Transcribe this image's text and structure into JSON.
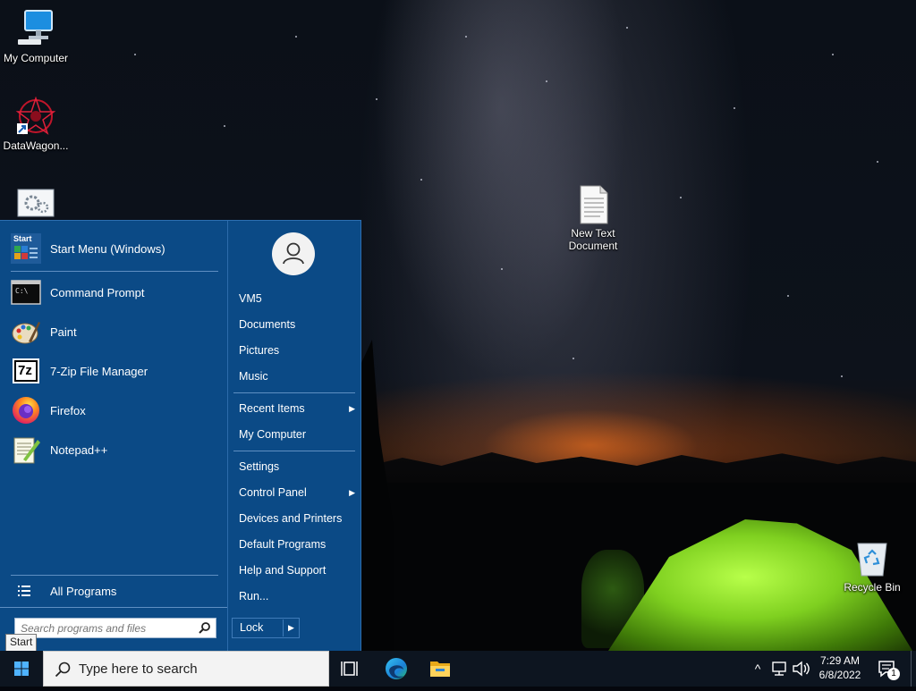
{
  "desktop": {
    "icons": [
      {
        "label": "My Computer"
      },
      {
        "label": "DataWagon..."
      },
      {
        "label": ""
      },
      {
        "label": "New Text Document"
      },
      {
        "label": "Recycle Bin"
      }
    ]
  },
  "start_menu": {
    "programs": [
      {
        "label": "Start Menu (Windows)",
        "icon": "start-menu-icon"
      },
      {
        "label": "Command Prompt",
        "icon": "command-prompt-icon"
      },
      {
        "label": "Paint",
        "icon": "paint-icon"
      },
      {
        "label": "7-Zip File Manager",
        "icon": "seven-zip-icon"
      },
      {
        "label": "Firefox",
        "icon": "firefox-icon"
      },
      {
        "label": "Notepad++",
        "icon": "notepad-plus-plus-icon"
      }
    ],
    "start_icon_text": "Start",
    "cmd_icon_text": "C:\\",
    "seven_zip_icon_text": "7z",
    "all_programs": "All Programs",
    "search_placeholder": "Search programs and files",
    "places": [
      {
        "label": "VM5"
      },
      {
        "label": "Documents"
      },
      {
        "label": "Pictures"
      },
      {
        "label": "Music"
      },
      {
        "label": "Recent Items",
        "submenu": true
      },
      {
        "label": "My Computer"
      },
      {
        "label": "Settings"
      },
      {
        "label": "Control Panel",
        "submenu": true
      },
      {
        "label": "Devices and Printers"
      },
      {
        "label": "Default Programs"
      },
      {
        "label": "Help and Support"
      },
      {
        "label": "Run..."
      }
    ],
    "submenu_arrow": "▶",
    "lock_label": "Lock",
    "lock_arrow": "▶"
  },
  "tooltip": "Start",
  "taskbar": {
    "search_placeholder": "Type here to search",
    "time": "7:29 AM",
    "date": "6/8/2022",
    "notification_count": "1",
    "tray_chevron": "^"
  },
  "colors": {
    "start_menu_bg": "#0b4a86",
    "taskbar_bg": "#0d1520"
  }
}
